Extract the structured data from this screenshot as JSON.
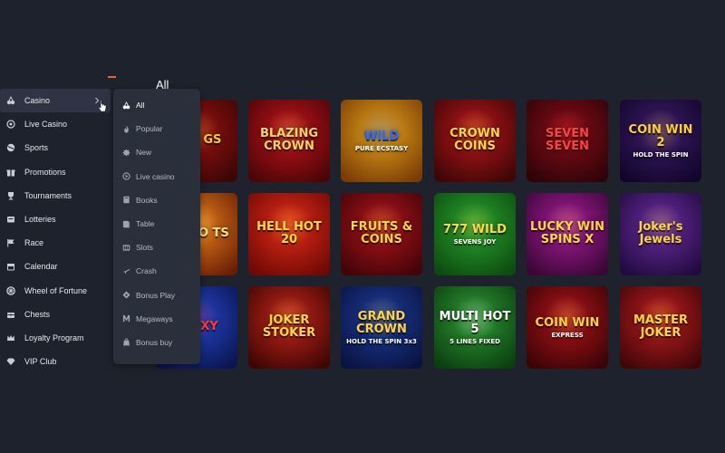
{
  "section_title": "All",
  "sidebar": {
    "items": [
      {
        "label": "Casino",
        "icon": "cherries-icon",
        "active": true
      },
      {
        "label": "Live Casino",
        "icon": "live-casino-icon"
      },
      {
        "label": "Sports",
        "icon": "ball-icon"
      },
      {
        "label": "Promotions",
        "icon": "gift-icon"
      },
      {
        "label": "Tournaments",
        "icon": "trophy-icon"
      },
      {
        "label": "Lotteries",
        "icon": "ticket-icon"
      },
      {
        "label": "Race",
        "icon": "flag-icon"
      },
      {
        "label": "Calendar",
        "icon": "calendar-icon"
      },
      {
        "label": "Wheel of Fortune",
        "icon": "wheel-icon"
      },
      {
        "label": "Chests",
        "icon": "chest-icon"
      },
      {
        "label": "Loyalty Program",
        "icon": "crown-icon"
      },
      {
        "label": "VIP Club",
        "icon": "diamond-icon"
      }
    ]
  },
  "dropdown": {
    "items": [
      {
        "label": "All",
        "icon": "cherries-icon",
        "active": true
      },
      {
        "label": "Popular",
        "icon": "fire-icon"
      },
      {
        "label": "New",
        "icon": "new-icon"
      },
      {
        "label": "Live casino",
        "icon": "live-icon"
      },
      {
        "label": "Books",
        "icon": "book-icon"
      },
      {
        "label": "Table",
        "icon": "table-icon"
      },
      {
        "label": "Slots",
        "icon": "slots-icon"
      },
      {
        "label": "Crash",
        "icon": "plane-icon"
      },
      {
        "label": "Bonus Play",
        "icon": "bonus-play-icon"
      },
      {
        "label": "Megaways",
        "icon": "megaways-icon"
      },
      {
        "label": "Bonus buy",
        "icon": "bonus-buy-icon"
      }
    ]
  },
  "games": [
    {
      "title": "UNE GS",
      "sub": "",
      "bg1": "#9a1111",
      "bg2": "#3a0606",
      "fg": "#f5c542"
    },
    {
      "title": "BLAZING CROWN",
      "sub": "",
      "bg1": "#c0141a",
      "bg2": "#4a0508",
      "fg": "#f7d36a"
    },
    {
      "title": "WILD",
      "sub": "PURE ECSTASY",
      "bg1": "#e3a21a",
      "bg2": "#7a3c06",
      "fg": "#2a6cff"
    },
    {
      "title": "CROWN COINS",
      "sub": "",
      "bg1": "#b8161a",
      "bg2": "#3d0607",
      "fg": "#ffd54a"
    },
    {
      "title": "SEVEN SEVEN",
      "sub": "",
      "bg1": "#8a0d18",
      "bg2": "#2d0309",
      "fg": "#ff4040"
    },
    {
      "title": "COIN WIN 2",
      "sub": "HOLD THE SPIN",
      "bg1": "#3d1d6c",
      "bg2": "#12052a",
      "fg": "#ffcf3a"
    },
    {
      "title": "RETRO TS",
      "sub": "",
      "bg1": "#e7801b",
      "bg2": "#6b1e06",
      "fg": "#ffe07a"
    },
    {
      "title": "HELL HOT 20",
      "sub": "",
      "bg1": "#e22b17",
      "bg2": "#6e0906",
      "fg": "#ffd84a"
    },
    {
      "title": "FRUITS & COINS",
      "sub": "",
      "bg1": "#b3141c",
      "bg2": "#400409",
      "fg": "#ffd34d"
    },
    {
      "title": "777 WILD",
      "sub": "SEVENS JOY",
      "bg1": "#2aa32e",
      "bg2": "#0d4c10",
      "fg": "#ffd84a"
    },
    {
      "title": "LUCKY WIN SPINS X",
      "sub": "",
      "bg1": "#a81b9b",
      "bg2": "#3a0735",
      "fg": "#ffd54a"
    },
    {
      "title": "Joker's Jewels",
      "sub": "",
      "bg1": "#6a2da1",
      "bg2": "#220a3f",
      "fg": "#ffd34a"
    },
    {
      "title": "7 PIXY",
      "sub": "",
      "bg1": "#2545c9",
      "bg2": "#0b1550",
      "fg": "#ff3a3a"
    },
    {
      "title": "JOKER STOKER",
      "sub": "",
      "bg1": "#c6251b",
      "bg2": "#3e0604",
      "fg": "#ffd64a"
    },
    {
      "title": "GRAND CROWN",
      "sub": "HOLD THE SPIN 3x3",
      "bg1": "#1e3d9c",
      "bg2": "#0a1340",
      "fg": "#ffd34a"
    },
    {
      "title": "MULTI HOT 5",
      "sub": "5 LINES FIXED",
      "bg1": "#2f9a35",
      "bg2": "#0b3f10",
      "fg": "#ffffff"
    },
    {
      "title": "COIN WIN",
      "sub": "EXPRESS",
      "bg1": "#b0141b",
      "bg2": "#3a0406",
      "fg": "#ffd24a"
    },
    {
      "title": "MASTER JOKER",
      "sub": "",
      "bg1": "#bf1d22",
      "bg2": "#3f0608",
      "fg": "#ffd54a"
    }
  ]
}
